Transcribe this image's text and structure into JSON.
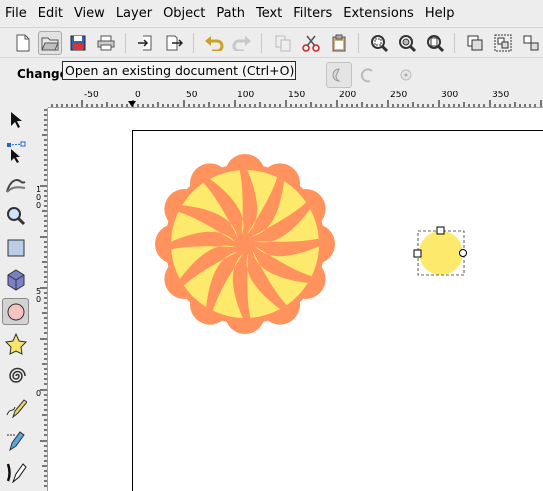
{
  "menubar": {
    "items": [
      "File",
      "Edit",
      "View",
      "Layer",
      "Object",
      "Path",
      "Text",
      "Filters",
      "Extensions",
      "Help"
    ]
  },
  "commands_bar": {
    "buttons": [
      {
        "name": "new-document",
        "icon": "new-document-icon"
      },
      {
        "name": "open-document",
        "icon": "folder-open-icon",
        "active": true
      },
      {
        "name": "save-document",
        "icon": "save-icon"
      },
      {
        "name": "print-document",
        "icon": "printer-icon"
      },
      {
        "name": "import",
        "icon": "import-icon"
      },
      {
        "name": "export",
        "icon": "export-icon"
      },
      {
        "name": "undo",
        "icon": "undo-icon"
      },
      {
        "name": "redo",
        "icon": "redo-icon"
      },
      {
        "name": "copy",
        "icon": "copy-icon"
      },
      {
        "name": "cut",
        "icon": "scissors-icon"
      },
      {
        "name": "paste",
        "icon": "clipboard-icon"
      },
      {
        "name": "zoom-selection",
        "icon": "zoom-selection-icon"
      },
      {
        "name": "zoom-drawing",
        "icon": "zoom-drawing-icon"
      },
      {
        "name": "zoom-page",
        "icon": "zoom-page-icon"
      },
      {
        "name": "duplicate",
        "icon": "duplicate-icon"
      },
      {
        "name": "group",
        "icon": "group-icon"
      },
      {
        "name": "ungroup",
        "icon": "ungroup-icon"
      }
    ]
  },
  "controls_bar": {
    "label": "Change",
    "tooltip": "Open an existing document (Ctrl+O)"
  },
  "rulers": {
    "horizontal_labels": [
      "-50",
      "0",
      "50",
      "100",
      "150",
      "200",
      "250",
      "300",
      "350"
    ],
    "vertical_labels": [
      "1 0 0",
      "5 0",
      "0"
    ]
  },
  "canvas": {
    "flower_colors": {
      "petal_outer": "#ff925d",
      "petal_inner": "#fdea6d"
    },
    "selected_circle_color": "#fdea6d"
  },
  "colors": {
    "background": "#ededed",
    "canvas": "#ffffff",
    "tooltip_bg": "#f6f6f6"
  }
}
